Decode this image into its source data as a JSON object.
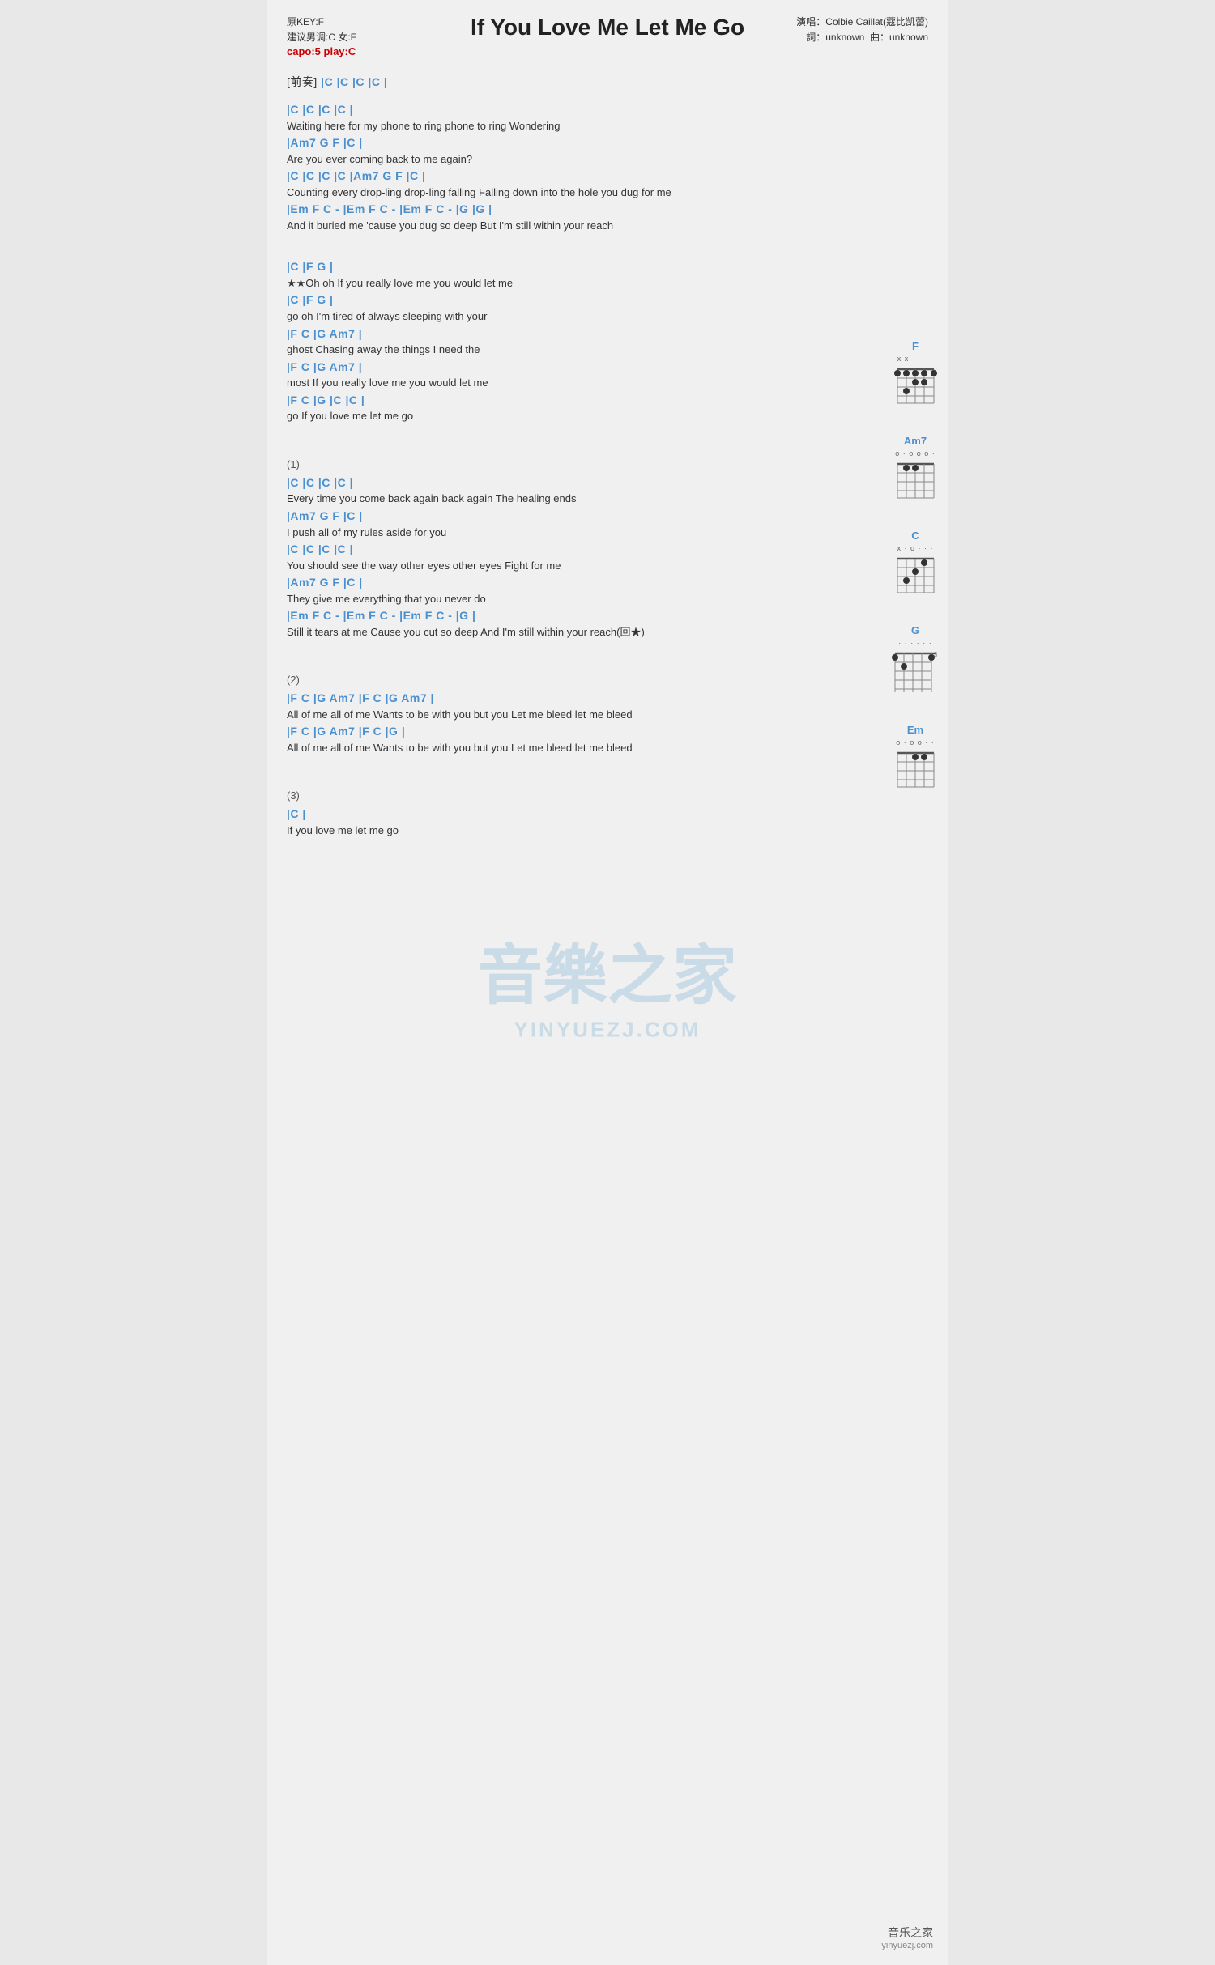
{
  "header": {
    "key_label": "原KEY:F",
    "suggest_label": "建议男调:C 女:F",
    "capo_label": "capo:5 play:C",
    "title": "If You Love Me Let Me Go",
    "artist_label": "演唱：Colbie Caillat(蔻比凯蕾)",
    "lyrics_label": "詞：unknown",
    "music_label": "曲：unknown"
  },
  "intro": {
    "label": "[前奏]",
    "chords": "|C  |C  |C  |C  |"
  },
  "sections": [
    {
      "id": "verse1",
      "lines": [
        {
          "chord": "|C                |C                |C         |C       |",
          "lyric": "Waiting here for my phone to ring    phone to ring Wondering"
        },
        {
          "chord": "|Am7    G         F        |C       |",
          "lyric": "Are you ever coming back to me again?"
        },
        {
          "chord": "|C              |C        |C        |C         |Am7     G         F              |C   |",
          "lyric": "Counting every drop-ling drop-ling falling    Falling down into the hole you dug for me"
        },
        {
          "chord": "|Em    F    C  -         |Em    F    C  -         |Em    F    C  -  |G   |G   |",
          "lyric": "And it buried me   'cause you dug   so  deep    But I'm still    within  your reach"
        }
      ]
    },
    {
      "id": "chorus",
      "lines": [
        {
          "chord": "  |C              |F               G              |",
          "lyric": "★Oh oh     If you really love me you would let me"
        },
        {
          "chord": "  |C              |F               G              |",
          "lyric": "go oh     I'm tired of always sleeping with your"
        },
        {
          "chord": "  |F    C    |G                Am7             |",
          "lyric": "ghost     Chasing away the things I need the"
        },
        {
          "chord": "  |F    C    |G                Am7             |",
          "lyric": "most     If you really love me you would let me"
        },
        {
          "chord": "  |F    C    |G               |C       |C      |",
          "lyric": "go       If you love me let me go"
        }
      ]
    },
    {
      "id": "verse2_label",
      "label": "(1)"
    },
    {
      "id": "verse2",
      "lines": [
        {
          "chord": "|C                    |C            |C               |C           |",
          "lyric": "Every time you come back again back again    The healing ends"
        },
        {
          "chord": "|Am7     G        F            |C         |",
          "lyric": "I push all of my rules aside for you"
        },
        {
          "chord": "|C                    |C            |C               |C           |",
          "lyric": "You should see the way other eyes other eyes    Fight for me"
        },
        {
          "chord": "|Am7     G        F                   |C         |",
          "lyric": "They give me everything that you never do"
        },
        {
          "chord": "   |Em    F    C  -         |Em    F    C  -         |Em    F    C  -  |G   |",
          "lyric": "Still it tears at me    Cause you cut so deep    And I'm still within your reach(回★)"
        }
      ]
    },
    {
      "id": "verse3_label",
      "label": "(2)"
    },
    {
      "id": "verse3",
      "lines": [
        {
          "chord": "|F       C    |G          Am7          |F       C    |G       Am7      |",
          "lyric": "All of me all of me  Wants to be with you but you    Let me bleed let me bleed"
        },
        {
          "chord": "|F       C    |G          Am7          |F       C    |G       |",
          "lyric": "All of me all of me  Wants to be with you but you    Let me bleed let me bleed"
        }
      ]
    },
    {
      "id": "verse4_label",
      "label": "(3)"
    },
    {
      "id": "verse4",
      "lines": [
        {
          "chord": "                    |C         |",
          "lyric": "If you love me let me go"
        }
      ]
    }
  ],
  "guitar_charts": [
    {
      "name": "F",
      "open": "x x o o o",
      "fret_note": "",
      "dots": [
        [
          0,
          3
        ],
        [
          1,
          3
        ],
        [
          2,
          2
        ],
        [
          3,
          1
        ]
      ]
    },
    {
      "name": "Am7",
      "open": "o o o",
      "fret_note": "",
      "dots": [
        [
          1,
          1
        ],
        [
          2,
          2
        ]
      ]
    },
    {
      "name": "C",
      "open": "x o o",
      "fret_note": "",
      "dots": [
        [
          0,
          2
        ],
        [
          1,
          3
        ],
        [
          2,
          1
        ]
      ]
    },
    {
      "name": "G",
      "open": "",
      "fret_note": "3",
      "dots": [
        [
          0,
          1
        ],
        [
          3,
          1
        ],
        [
          3,
          2
        ],
        [
          3,
          3
        ]
      ]
    },
    {
      "name": "Em",
      "open": "o o o o",
      "fret_note": "",
      "dots": [
        [
          0,
          2
        ],
        [
          1,
          2
        ]
      ]
    }
  ],
  "watermark": {
    "site": "音樂之家",
    "url": "YINYUEZJ.COM"
  },
  "bottom_logo": {
    "name": "音乐之家",
    "url": "yinyuezj.com"
  }
}
